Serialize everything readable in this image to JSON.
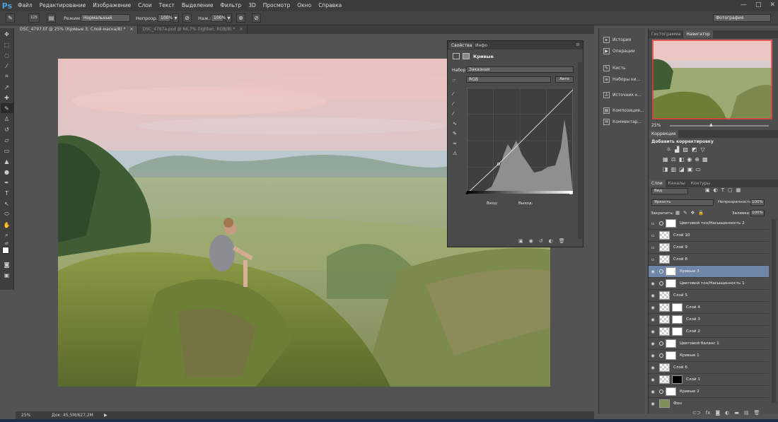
{
  "app": {
    "logo": "Ps"
  },
  "menu": [
    "Файл",
    "Редактирование",
    "Изображение",
    "Слои",
    "Текст",
    "Выделение",
    "Фильтр",
    "3D",
    "Просмотр",
    "Окно",
    "Справка"
  ],
  "window_controls": [
    "—",
    "□",
    "✕"
  ],
  "options": {
    "brush_size": "125",
    "mode_label": "Режим:",
    "mode_value": "Нормальный",
    "opacity_label": "Непрозр.:",
    "opacity_value": "100%",
    "flow_label": "Наж.:",
    "flow_value": "100%",
    "workspace": "Фотография"
  },
  "tabs": [
    {
      "label": "DSC_4797.tif @ 25% (Кривые 3, Слой-маска/8) *",
      "close": "×"
    },
    {
      "label": "DSC_4797a.psd @ 66,7% (lighten, RGB/8) *",
      "close": "×"
    }
  ],
  "status": {
    "zoom": "25%",
    "doc": "Док: 45,5M/627,2M"
  },
  "properties": {
    "tab_props": "Свойства",
    "tab_info": "Инфо",
    "title": "Кривые",
    "preset_label": "Набор:",
    "preset_value": "Заказная",
    "channel_value": "RGB",
    "auto_label": "Авто",
    "input_label": "Вход:",
    "output_label": "Выход:"
  },
  "dock": [
    "История",
    "Операции",
    "Кисть",
    "Наборы ки...",
    "Источник к...",
    "Композиция...",
    "Комментар..."
  ],
  "navigator": {
    "tab_hist": "Гистограмма",
    "tab_nav": "Навигатор",
    "zoom": "25%"
  },
  "corrections": {
    "title": "Коррекция",
    "add_label": "Добавить корректировку"
  },
  "layers_panel": {
    "tabs": [
      "Слои",
      "Каналы",
      "Контуры"
    ],
    "kind": "Вид",
    "blend": "Яркость",
    "opacity_label": "Непрозрачность:",
    "opacity_value": "100%",
    "lock_label": "Закрепить:",
    "fill_label": "Заливка:",
    "fill_value": "100%",
    "layers": [
      {
        "name": "Цветовой тон/Насыщенность 2",
        "type": "adj",
        "visible": false
      },
      {
        "name": "Слой 10",
        "type": "pix",
        "visible": false
      },
      {
        "name": "Слой 9",
        "type": "pix",
        "visible": false
      },
      {
        "name": "Слой 8",
        "type": "pix",
        "visible": false
      },
      {
        "name": "Кривые 3",
        "type": "adj",
        "visible": true,
        "selected": true
      },
      {
        "name": "Цветовой тон/Насыщенность 1",
        "type": "adj",
        "visible": true
      },
      {
        "name": "Слой 5",
        "type": "pix",
        "visible": true
      },
      {
        "name": "Слой 4",
        "type": "pixmask",
        "visible": true
      },
      {
        "name": "Слой 3",
        "type": "pixmask",
        "visible": true
      },
      {
        "name": "Слой 2",
        "type": "pixmask",
        "visible": true
      },
      {
        "name": "Цветовой баланс 1",
        "type": "adj",
        "visible": true
      },
      {
        "name": "Кривые 1",
        "type": "adj",
        "visible": true
      },
      {
        "name": "Слой 6",
        "type": "pix",
        "visible": true
      },
      {
        "name": "Слой 1",
        "type": "pixmask",
        "visible": true
      },
      {
        "name": "Кривые 2",
        "type": "adj",
        "visible": true
      },
      {
        "name": "Фон",
        "type": "bg",
        "visible": true
      }
    ]
  },
  "colors": {
    "accent_selected": "#6e86a8",
    "panel": "#4d4d4d",
    "ps_blue": "#4aa3df"
  }
}
